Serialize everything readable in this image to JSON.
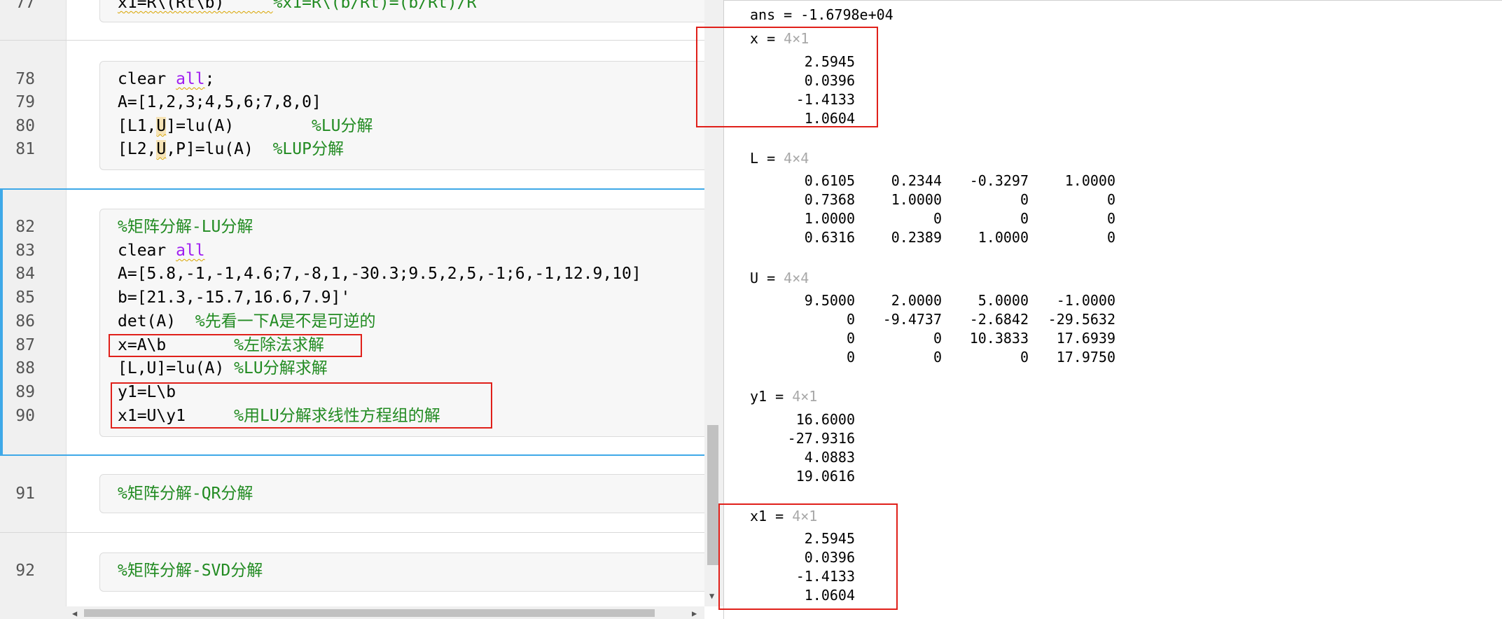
{
  "editor": {
    "line77": {
      "num": "77",
      "code": "x1=R\\(Rt\\b)     ",
      "comment": "%x1=R\\(b/Rt)=(b/Rt)/R"
    },
    "line78": {
      "num": "78",
      "pre": "clear ",
      "kw": "all",
      "post": ";"
    },
    "line79": {
      "num": "79",
      "code": "A=[1,2,3;4,5,6;7,8,0]"
    },
    "line80": {
      "num": "80",
      "pre": "[L1,",
      "hl": "U",
      "post": "]=lu(A)        ",
      "comment": "%LU分解"
    },
    "line81": {
      "num": "81",
      "pre": "[L2,",
      "hl": "U",
      "post": ",P]=lu(A)  ",
      "comment": "%LUP分解"
    },
    "line82": {
      "num": "82",
      "comment": "%矩阵分解-LU分解"
    },
    "line83": {
      "num": "83",
      "pre": "clear ",
      "kw": "all"
    },
    "line84": {
      "num": "84",
      "code": "A=[5.8,-1,-1,4.6;7,-8,1,-30.3;9.5,2,5,-1;6,-1,12.9,10]"
    },
    "line85": {
      "num": "85",
      "code": "b=[21.3,-15.7,16.6,7.9]'"
    },
    "line86": {
      "num": "86",
      "code": "det(A)  ",
      "comment": "%先看一下A是不是可逆的"
    },
    "line87": {
      "num": "87",
      "code": "x=A\\b       ",
      "comment": "%左除法求解"
    },
    "line88": {
      "num": "88",
      "code": "[L,U]=lu(A) ",
      "comment": "%LU分解求解"
    },
    "line89": {
      "num": "89",
      "code": "y1=L\\b"
    },
    "line90": {
      "num": "90",
      "code": "x1=U\\y1     ",
      "comment": "%用LU分解求线性方程组的解"
    },
    "line91": {
      "num": "91",
      "comment": "%矩阵分解-QR分解"
    },
    "line92": {
      "num": "92",
      "comment": "%矩阵分解-SVD分解"
    }
  },
  "command_window": {
    "ans_line": "ans = -1.6798e+04",
    "x": {
      "label": "x = ",
      "size": "4×1",
      "values": [
        "2.5945",
        "0.0396",
        "-1.4133",
        "1.0604"
      ]
    },
    "L": {
      "label": "L = ",
      "size": "4×4",
      "rows": [
        [
          "0.6105",
          "0.2344",
          "-0.3297",
          "1.0000"
        ],
        [
          "0.7368",
          "1.0000",
          "0",
          "0"
        ],
        [
          "1.0000",
          "0",
          "0",
          "0"
        ],
        [
          "0.6316",
          "0.2389",
          "1.0000",
          "0"
        ]
      ]
    },
    "U": {
      "label": "U = ",
      "size": "4×4",
      "rows": [
        [
          "9.5000",
          "2.0000",
          "5.0000",
          "-1.0000"
        ],
        [
          "0",
          "-9.4737",
          "-2.6842",
          "-29.5632"
        ],
        [
          "0",
          "0",
          "10.3833",
          "17.6939"
        ],
        [
          "0",
          "0",
          "0",
          "17.9750"
        ]
      ]
    },
    "y1": {
      "label": "y1 = ",
      "size": "4×1",
      "values": [
        "16.6000",
        "-27.9316",
        "4.0883",
        "19.0616"
      ]
    },
    "x1": {
      "label": "x1 = ",
      "size": "4×1",
      "values": [
        "2.5945",
        "0.0396",
        "-1.4133",
        "1.0604"
      ]
    }
  },
  "colors": {
    "comment": "#228b22",
    "keyword": "#a020f0",
    "annotation_box": "#e0201a",
    "active_section": "#3fa9e8"
  }
}
